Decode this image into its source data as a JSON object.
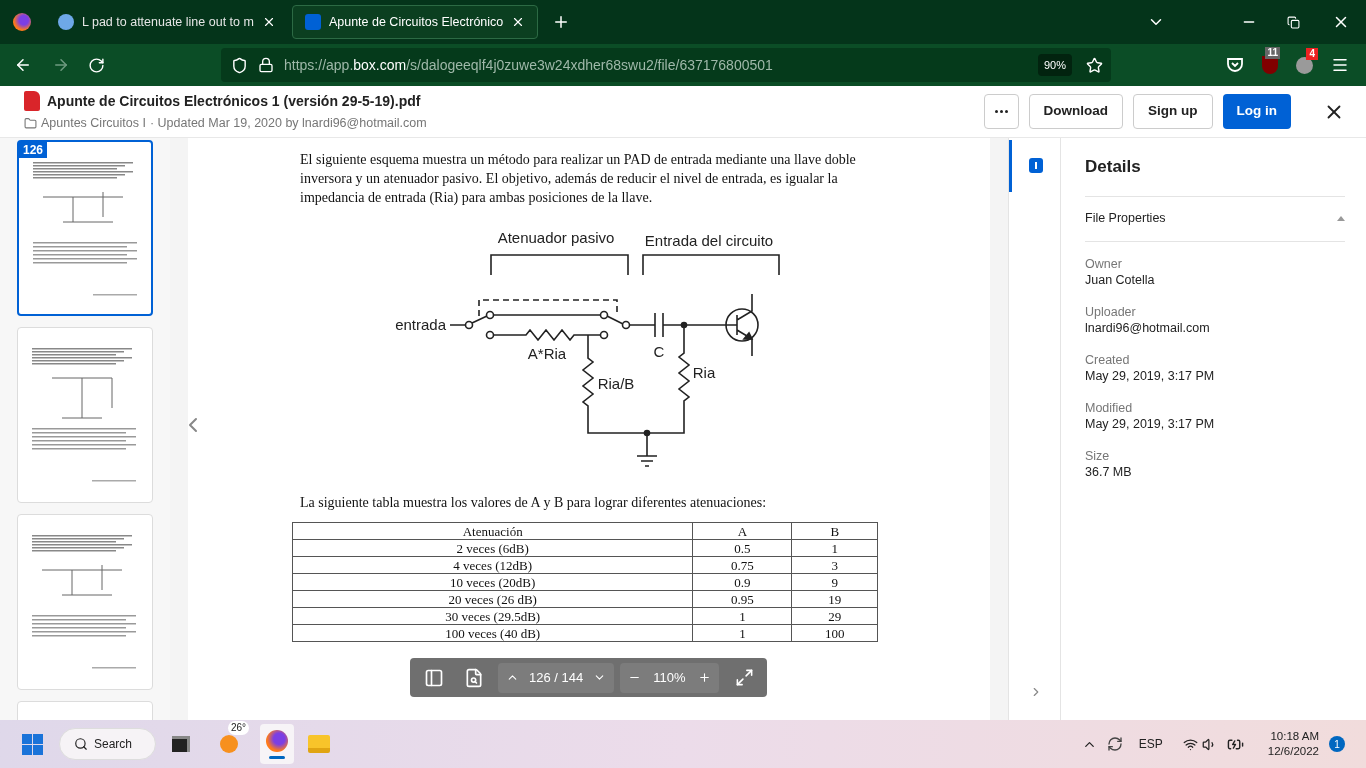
{
  "browser": {
    "tabs": [
      {
        "title": "L pad to attenuate line out to m",
        "selected": false
      },
      {
        "title": "Apunte de Circuitos Electrónico",
        "selected": true
      }
    ],
    "url": {
      "prefix": "https://app.",
      "host": "box.com",
      "path": "/s/dalogeeqlf4j0zuwe3w24xdher68swu2/file/637176800501"
    },
    "zoom": "90%",
    "extension_badges": [
      "11",
      "4"
    ]
  },
  "header": {
    "file_name": "Apunte de Circuitos Electrónicos 1 (versión 29-5-19).pdf",
    "folder": "Apuntes Circuitos I",
    "updated": "· Updated Mar 19, 2020 by lnardi96@hotmail.com",
    "buttons": [
      "Download",
      "Sign up",
      "Log in"
    ]
  },
  "thumbnails": [
    {
      "page": "126",
      "selected": true
    },
    {
      "selected": false
    },
    {
      "selected": false
    },
    {
      "selected": false
    }
  ],
  "document": {
    "intro": "El siguiente esquema muestra un método para realizar un PAD de entrada mediante una llave doble inversora y un atenuador pasivo. El objetivo, además de reducir el nivel de entrada, es igualar la impedancia de entrada (Ria) para ambas posiciones de la llave.",
    "diagram": {
      "group_labels": [
        "Atenuador pasivo",
        "Entrada del circuito"
      ],
      "input_label": "entrada",
      "component_labels": [
        "A*Ria",
        "C",
        "Ria/B",
        "Ria"
      ]
    },
    "table_intro": "La siguiente tabla muestra los valores de A y B para lograr diferentes atenuaciones:",
    "table": {
      "columns": [
        "Atenuación",
        "A",
        "B"
      ],
      "rows": [
        [
          "2 veces (6dB)",
          "0.5",
          "1"
        ],
        [
          "4 veces (12dB)",
          "0.75",
          "3"
        ],
        [
          "10 veces (20dB)",
          "0.9",
          "9"
        ],
        [
          "20 veces (26 dB)",
          "0.95",
          "19"
        ],
        [
          "30 veces (29.5dB)",
          "1",
          "29"
        ],
        [
          "100 veces (40 dB)",
          "1",
          "100"
        ]
      ]
    }
  },
  "viewer_toolbar": {
    "page": "126 / 144",
    "zoom": "110%"
  },
  "details": {
    "title": "Details",
    "section": {
      "title": "File Properties",
      "expanded": true
    },
    "properties": [
      {
        "label": "Owner",
        "value": "Juan Cotella"
      },
      {
        "label": "Uploader",
        "value": "lnardi96@hotmail.com"
      },
      {
        "label": "Created",
        "value": "May 29, 2019, 3:17 PM"
      },
      {
        "label": "Modified",
        "value": "May 29, 2019, 3:17 PM"
      },
      {
        "label": "Size",
        "value": "36.7 MB"
      }
    ]
  },
  "taskbar": {
    "search": "Search",
    "weather": "26°",
    "language": "ESP",
    "time": "10:18 AM",
    "date": "12/6/2022",
    "notifications": "1"
  }
}
